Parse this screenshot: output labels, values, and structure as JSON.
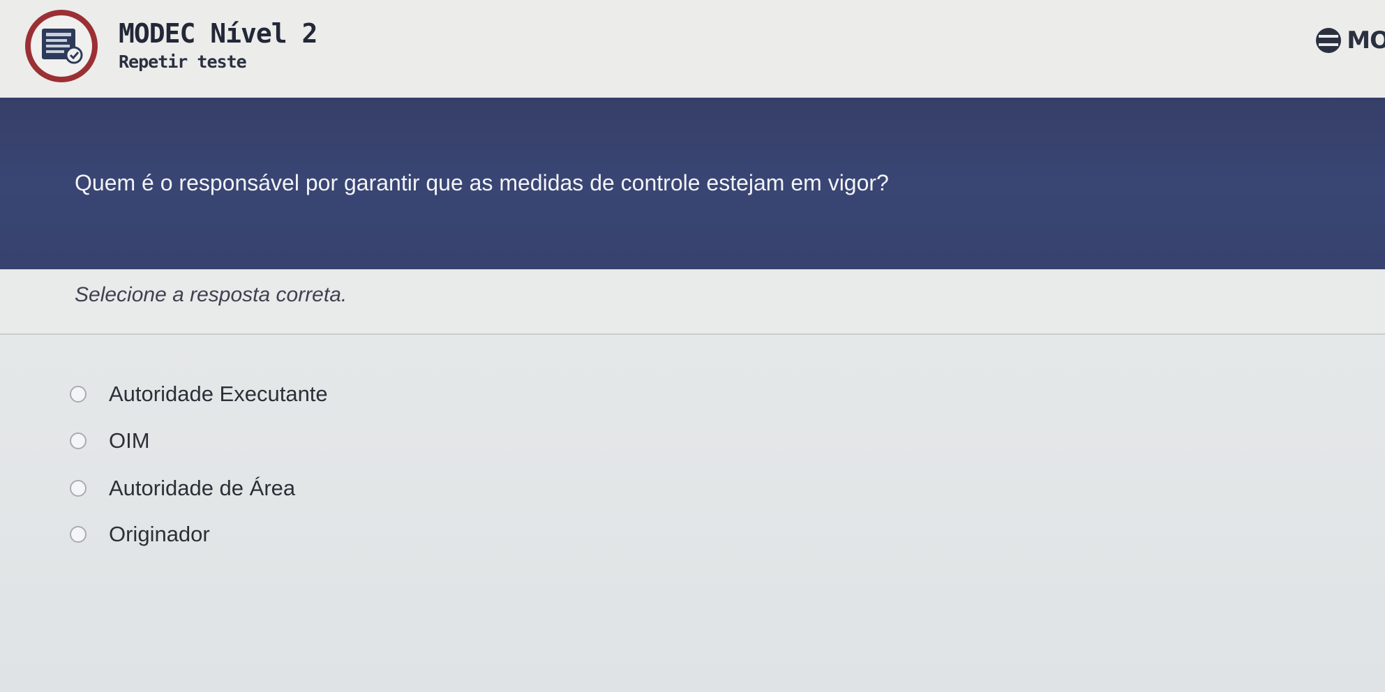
{
  "header": {
    "title": "MODEC Nível 2",
    "subtitle": "Repetir teste",
    "logo_icon": "document-list-icon",
    "brand_text": "MO",
    "brand_icon": "modec-logo-icon"
  },
  "question": {
    "text": "Quem é o responsável por garantir que as medidas de controle estejam em vigor?"
  },
  "instruction": {
    "text": "Selecione a resposta correta."
  },
  "options": [
    {
      "label": "Autoridade Executante",
      "selected": false
    },
    {
      "label": "OIM",
      "selected": false
    },
    {
      "label": "Autoridade de Área",
      "selected": false
    },
    {
      "label": "Originador",
      "selected": false
    }
  ],
  "colors": {
    "banner": "#394573",
    "logo_ring": "#9b3034",
    "background": "#e6e8e8"
  }
}
